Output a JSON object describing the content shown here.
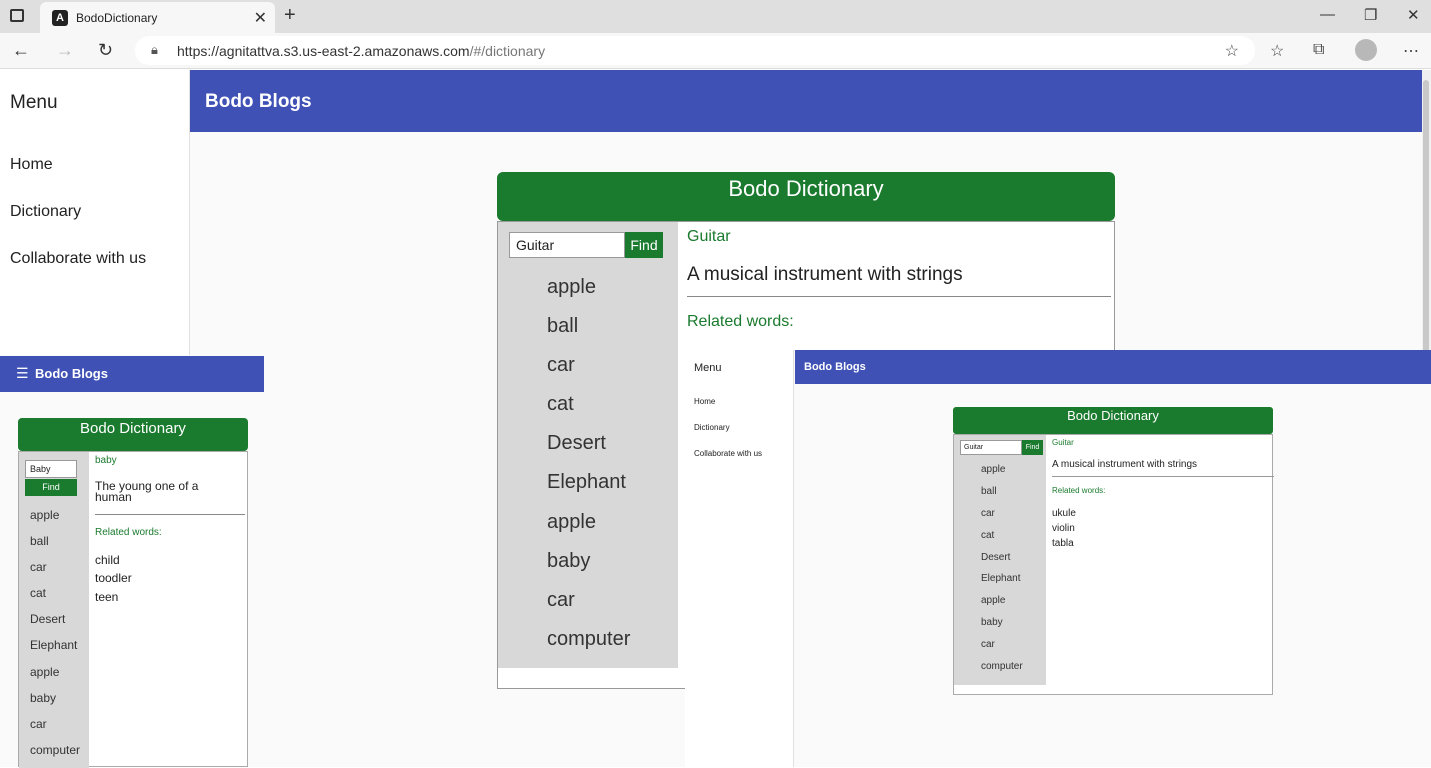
{
  "browser": {
    "tab_title": "BodoDictionary",
    "tab_logo": "A",
    "url_host": "https://agnitattva.s3.us-east-2.amazonaws.com",
    "url_path": "/#/dictionary"
  },
  "sidenav": {
    "title": "Menu",
    "links": [
      "Home",
      "Dictionary",
      "Collaborate with us"
    ]
  },
  "topbar": {
    "title": "Bodo Blogs"
  },
  "dictionary": {
    "header": "Bodo Dictionary",
    "search_value": "Guitar",
    "find_label": "Find",
    "words": [
      "apple",
      "ball",
      "car",
      "cat",
      "Desert",
      "Elephant",
      "apple",
      "baby",
      "car",
      "computer"
    ],
    "selected_word": "Guitar",
    "definition": "A musical instrument with strings",
    "related_label": "Related words:"
  },
  "mobile_preview": {
    "topbar_title": "Bodo Blogs",
    "header": "Bodo Dictionary",
    "search_value": "Baby",
    "find_label": "Find",
    "words": [
      "apple",
      "ball",
      "car",
      "cat",
      "Desert",
      "Elephant",
      "apple",
      "baby",
      "car",
      "computer"
    ],
    "selected_word": "baby",
    "definition": "The young one of a human",
    "related_label": "Related words:",
    "related_words": [
      "child",
      "toodler",
      "teen"
    ]
  },
  "desktop_preview": {
    "menu_title": "Menu",
    "links": [
      "Home",
      "Dictionary",
      "Collaborate with us"
    ],
    "topbar_title": "Bodo Blogs",
    "header": "Bodo Dictionary",
    "search_value": "Guitar",
    "find_label": "Find",
    "words": [
      "apple",
      "ball",
      "car",
      "cat",
      "Desert",
      "Elephant",
      "apple",
      "baby",
      "car",
      "computer"
    ],
    "selected_word": "Guitar",
    "definition": "A musical instrument with strings",
    "related_label": "Related words:",
    "related_words": [
      "ukule",
      "violin",
      "tabla"
    ]
  },
  "colors": {
    "primary": "#3f51b5",
    "green": "#1a7a2e",
    "panel": "#d8d8d8"
  }
}
